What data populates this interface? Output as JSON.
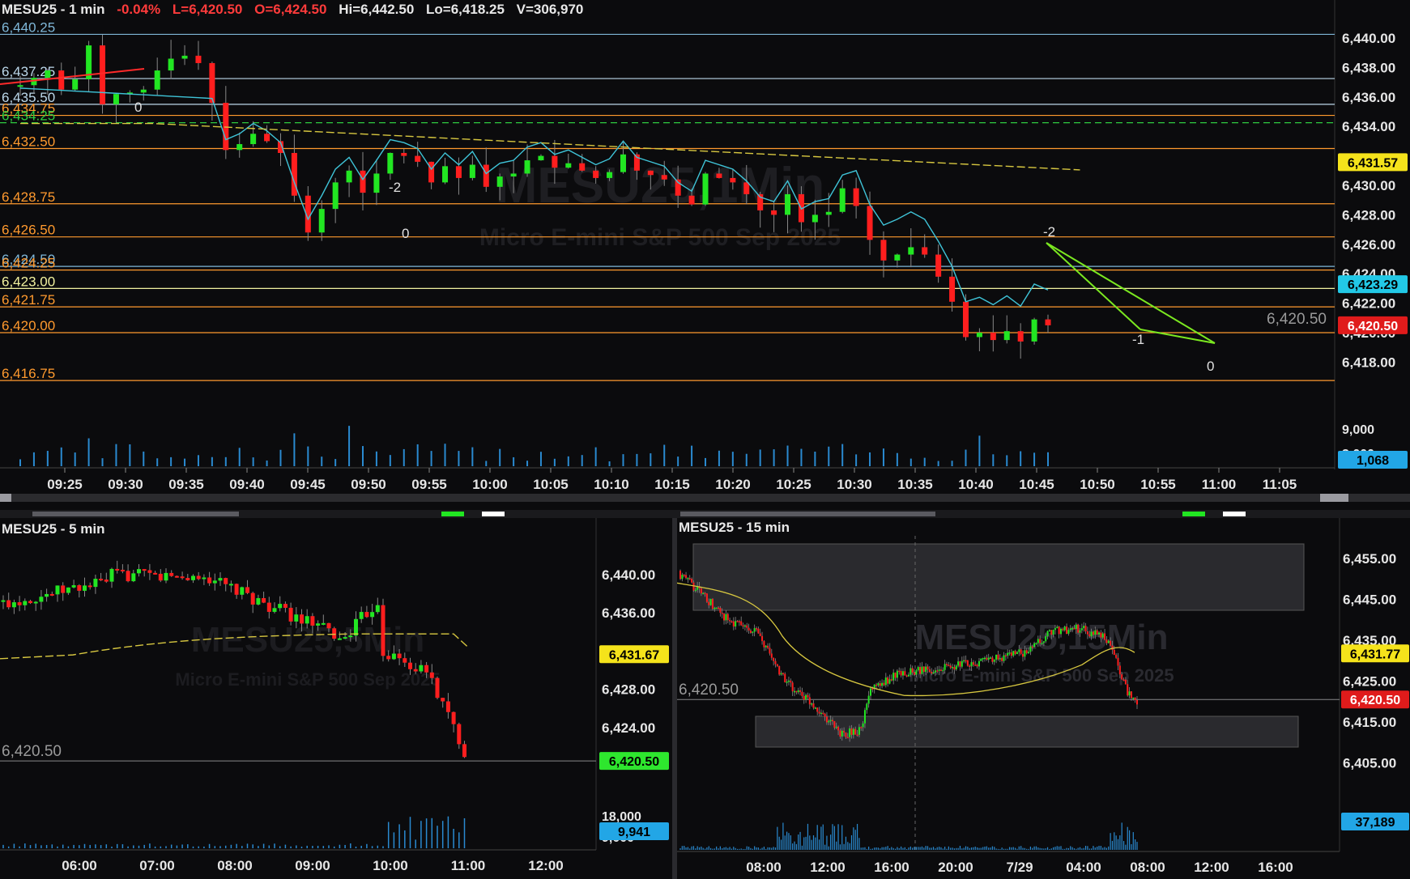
{
  "main_chart": {
    "symbol_label": "MESU25 - 1 min",
    "change": "-0.04%",
    "last": "L=6,420.50",
    "open": "O=6,424.50",
    "high": "Hi=6,442.50",
    "low": "Lo=6,418.25",
    "volume": "V=306,970",
    "watermark_title": "MESU25,1Min",
    "watermark_sub": "Micro E-mini S&P 500 Sep 2025",
    "y_ticks": [
      "6,440.00",
      "6,438.00",
      "6,436.00",
      "6,434.00",
      "6,430.00",
      "6,428.00",
      "6,426.00",
      "6,424.00",
      "6,422.00",
      "6,420.00",
      "6,418.00"
    ],
    "y_tick_values": [
      6440,
      6438,
      6436,
      6434,
      6430,
      6428,
      6426,
      6424,
      6422,
      6420,
      6418
    ],
    "volume_ticks": [
      "9,000",
      "3,000"
    ],
    "x_ticks": [
      "09:25",
      "09:30",
      "09:35",
      "09:40",
      "09:45",
      "09:50",
      "09:55",
      "10:00",
      "10:05",
      "10:10",
      "10:15",
      "10:20",
      "10:25",
      "10:30",
      "10:35",
      "10:40",
      "10:45",
      "10:50",
      "10:55",
      "11:00",
      "11:05"
    ],
    "price_lines": [
      {
        "label": "6,440.25",
        "value": 6440.25,
        "color": "#7fb7d8"
      },
      {
        "label": "6,437.25",
        "value": 6437.25,
        "color": "#bcd8ea"
      },
      {
        "label": "6,435.50",
        "value": 6435.5,
        "color": "#bcd8ea"
      },
      {
        "label": "6,434.75",
        "value": 6434.75,
        "color": "#ff9a2e"
      },
      {
        "label": "6,434.25",
        "value": 6434.25,
        "color": "#2ecc40"
      },
      {
        "label": "6,432.50",
        "value": 6432.5,
        "color": "#ff9a2e"
      },
      {
        "label": "6,428.75",
        "value": 6428.75,
        "color": "#ff9a2e"
      },
      {
        "label": "6,426.50",
        "value": 6426.5,
        "color": "#ff9a2e"
      },
      {
        "label": "6,424.50",
        "value": 6424.5,
        "color": "#7fb7d8"
      },
      {
        "label": "6,424.25",
        "value": 6424.25,
        "color": "#ff9a2e"
      },
      {
        "label": "6,423.00",
        "value": 6423,
        "color": "#f2f2a0"
      },
      {
        "label": "6,421.75",
        "value": 6421.75,
        "color": "#ff9a2e"
      },
      {
        "label": "6,420.00",
        "value": 6420,
        "color": "#ff9a2e"
      },
      {
        "label": "6,416.75",
        "value": 6416.75,
        "color": "#ff9a2e"
      }
    ],
    "badges": [
      {
        "text": "6,431.57",
        "value": 6431.57,
        "bg": "#f5e31b",
        "fg": "#000000"
      },
      {
        "text": "6,423.29",
        "value": 6423.29,
        "bg": "#22c8e6",
        "fg": "#000000"
      },
      {
        "text": "6,420.50",
        "value": 6420.5,
        "bg": "#e01b1b",
        "fg": "#ffffff"
      }
    ],
    "volume_badge": {
      "text": "1,068",
      "bg": "#22a6e6",
      "fg": "#000000"
    },
    "last_price_label": "6,420.50",
    "annotations": [
      "0",
      "-2",
      "0",
      "-2",
      "-1",
      "0"
    ]
  },
  "chart_5min": {
    "symbol_label": "MESU25 - 5 min",
    "watermark_title": "MESU25,5Min",
    "watermark_sub": "Micro E-mini S&P 500 Sep 2025",
    "y_ticks": [
      "6,440.00",
      "6,436.00",
      "6,428.00",
      "6,424.00"
    ],
    "y_tick_values": [
      6440,
      6436,
      6428,
      6424
    ],
    "volume_ticks": [
      "18,000",
      "9,000"
    ],
    "x_ticks": [
      "06:00",
      "07:00",
      "08:00",
      "09:00",
      "10:00",
      "11:00",
      "12:00"
    ],
    "last_price_label": "6,420.50",
    "badges": [
      {
        "text": "6,431.67",
        "value": 6431.67,
        "bg": "#f5e31b",
        "fg": "#000000"
      },
      {
        "text": "6,420.50",
        "value": 6420.5,
        "bg": "#2ee62e",
        "fg": "#000000"
      }
    ],
    "volume_badge": {
      "text": "9,941",
      "bg": "#22a6e6",
      "fg": "#000000"
    }
  },
  "chart_15min": {
    "symbol_label": "MESU25 - 15 min",
    "watermark_title": "MESU25,15Min",
    "watermark_sub": "Micro E-mini S&P 500 Sep 2025",
    "y_ticks": [
      "6,455.00",
      "6,445.00",
      "6,435.00",
      "6,425.00",
      "6,415.00",
      "6,405.00"
    ],
    "y_tick_values": [
      6455,
      6445,
      6435,
      6425,
      6415,
      6405
    ],
    "x_ticks": [
      "08:00",
      "12:00",
      "16:00",
      "20:00",
      "7/29",
      "04:00",
      "08:00",
      "12:00",
      "16:00"
    ],
    "last_price_label": "6,420.50",
    "badges": [
      {
        "text": "6,431.77",
        "value": 6431.77,
        "bg": "#f5e31b",
        "fg": "#000000"
      },
      {
        "text": "6,420.50",
        "value": 6420.5,
        "bg": "#e01b1b",
        "fg": "#ffffff"
      }
    ],
    "volume_badge": {
      "text": "37,189",
      "bg": "#22a6e6",
      "fg": "#000000"
    }
  },
  "colors": {
    "up": "#22e622",
    "down": "#ff1e1e",
    "ema_cyan": "#3fc4d8",
    "sma_yellow": "#d8c840",
    "text": "#e6e6e6"
  }
}
